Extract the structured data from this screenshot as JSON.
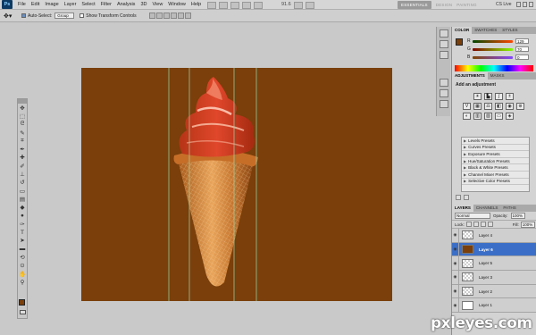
{
  "app": {
    "logo": "Ps"
  },
  "menu": [
    "File",
    "Edit",
    "Image",
    "Layer",
    "Select",
    "Filter",
    "Analysis",
    "3D",
    "View",
    "Window",
    "Help"
  ],
  "zoom": "91.6",
  "workspaces": [
    "ESSENTIALS",
    "DESIGN",
    "PAINTING"
  ],
  "account": "CS Live",
  "options": {
    "auto_select_label": "Auto-Select:",
    "auto_select_value": "Group",
    "show_transform_label": "Show Transform Controls"
  },
  "color_panel": {
    "tabs": [
      "COLOR",
      "SWATCHES",
      "STYLES"
    ],
    "R": "129",
    "G": "70",
    "B": "0",
    "fg_color": "#7a3f0a"
  },
  "adjustments_panel": {
    "tabs": [
      "ADJUSTMENTS",
      "MASKS"
    ],
    "title": "Add an adjustment",
    "presets": [
      "Levels Presets",
      "Curves Presets",
      "Exposure Presets",
      "Hue/Saturation Presets",
      "Black & White Presets",
      "Channel Mixer Presets",
      "Selective Color Presets"
    ]
  },
  "layers_panel": {
    "tabs": [
      "LAYERS",
      "CHANNELS",
      "PATHS"
    ],
    "blend_mode": "Normal",
    "opacity_label": "Opacity:",
    "opacity": "100%",
    "lock_label": "Lock:",
    "fill_label": "Fill:",
    "fill": "100%",
    "layers": [
      {
        "name": "Layer 4",
        "selected": false,
        "thumb": "checker"
      },
      {
        "name": "Layer 6",
        "selected": true,
        "thumb": "brown"
      },
      {
        "name": "Layer 5",
        "selected": false,
        "thumb": "checker"
      },
      {
        "name": "Layer 3",
        "selected": false,
        "thumb": "checker"
      },
      {
        "name": "Layer 2",
        "selected": false,
        "thumb": "checker"
      },
      {
        "name": "Layer 1",
        "selected": false,
        "thumb": "white"
      }
    ]
  },
  "canvas": {
    "background": "#7a3f0a"
  },
  "watermark": "pxleyes.com"
}
